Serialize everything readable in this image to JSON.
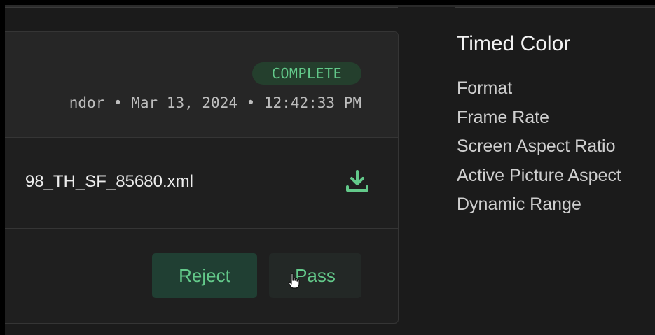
{
  "review_card": {
    "status_badge": "COMPLETE",
    "meta_line": "ndor • Mar 13, 2024 • 12:42:33 PM",
    "file_name": "98_TH_SF_85680.xml",
    "download_icon": "download-icon",
    "reject_label": "Reject",
    "pass_label": "Pass"
  },
  "side_panel": {
    "title": "Timed Color",
    "fields": [
      "Format",
      "Frame Rate",
      "Screen Aspect Ratio",
      "Active Picture Aspect",
      "Dynamic Range"
    ]
  },
  "colors": {
    "accent": "#63c98a",
    "background": "#1b1b1b",
    "card": "#1f1f1f",
    "card_header": "#262626"
  }
}
